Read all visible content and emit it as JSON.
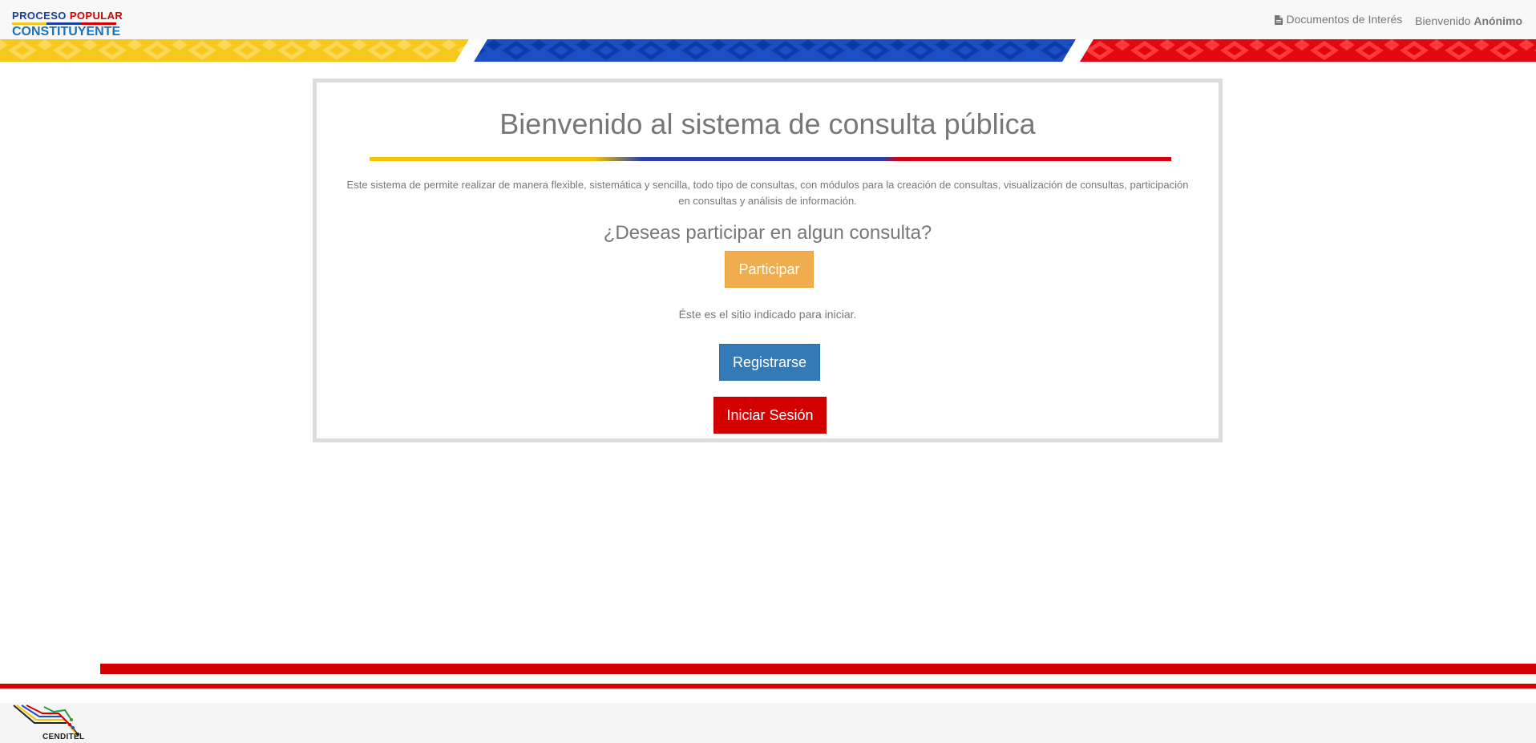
{
  "navbar": {
    "logo_top": [
      "PROCESO",
      " ",
      "POPULAR"
    ],
    "logo_bottom": "CONSTITUYENTE",
    "documents_link": "Documentos de Interés",
    "welcome_prefix": "Bienvenido",
    "welcome_user": "Anónimo"
  },
  "main": {
    "title": "Bienvenido al sistema de consulta pública",
    "description": "Este sistema de permite realizar de manera flexible, sistemática y sencilla, todo tipo de consultas, con módulos para la creación de consultas, visualización de consultas, participación en consultas y análisis de información.",
    "question": "¿Deseas participar en algun consulta?",
    "participar_label": "Participar",
    "hint": "Éste es el sitio indicado para iniciar.",
    "register_label": "Registrarse",
    "login_label": "Iniciar Sesión"
  },
  "footer": {
    "logo_label": "CENDITEL"
  },
  "colors": {
    "yellow": "#f5c400",
    "blue": "#1c4fc4",
    "red": "#d40000",
    "warning": "#f0ad4e",
    "primary": "#337ab7"
  },
  "icons": [
    "document-icon"
  ]
}
